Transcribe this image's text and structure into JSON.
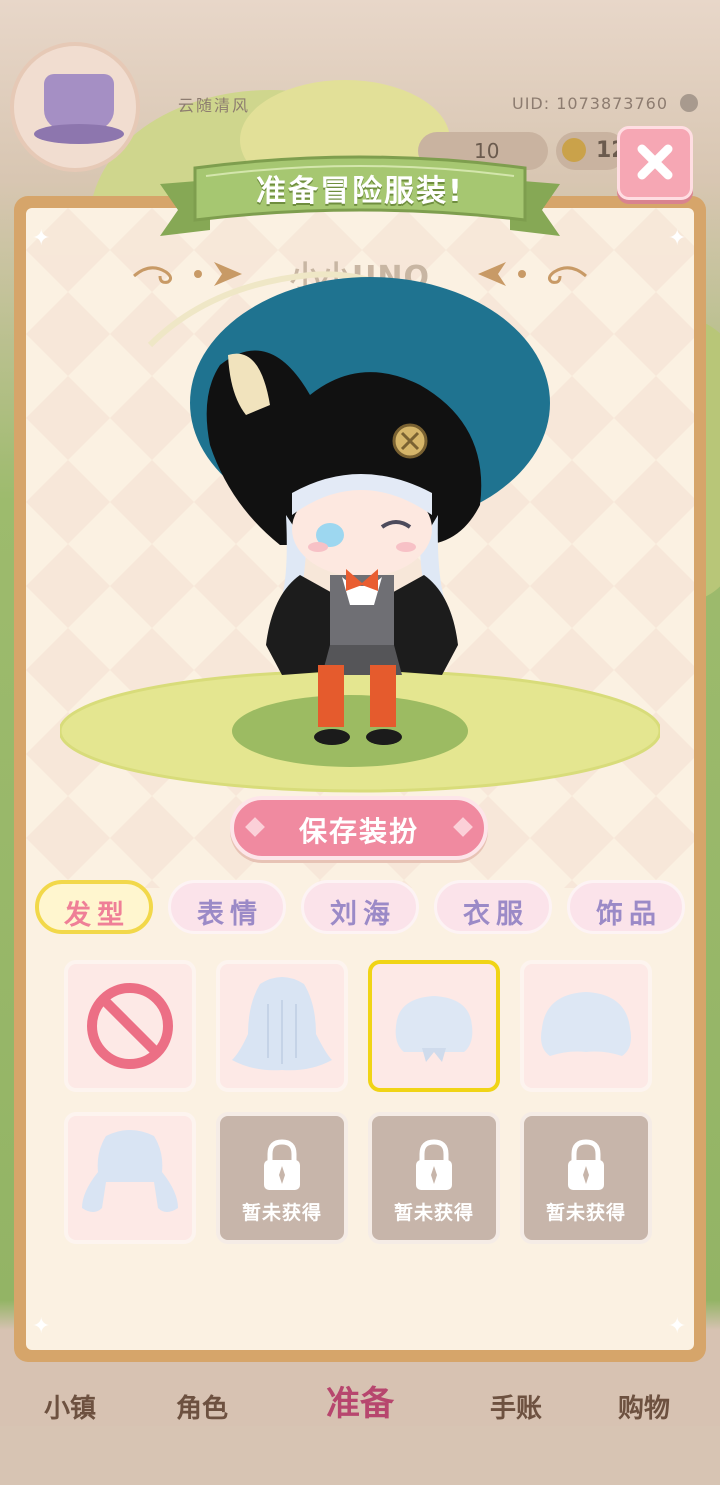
{
  "background": {
    "player_name": "云随清风",
    "uid": "UID: 1073873760",
    "currency_1": "10",
    "currency_2": "12",
    "bottom_nav": [
      "小镇",
      "角色",
      "准备",
      "手账",
      "购物"
    ]
  },
  "modal": {
    "title": "准备冒险服装!",
    "character_name": "小小UNO",
    "save_label": "保存装扮",
    "tabs": [
      {
        "label": "发型",
        "active": true
      },
      {
        "label": "表情",
        "active": false
      },
      {
        "label": "刘海",
        "active": false
      },
      {
        "label": "衣服",
        "active": false
      },
      {
        "label": "饰品",
        "active": false
      }
    ],
    "items": [
      {
        "type": "none-icon",
        "state": "available"
      },
      {
        "type": "long-hair",
        "state": "available"
      },
      {
        "type": "short-hair",
        "state": "selected"
      },
      {
        "type": "bob-hair",
        "state": "available"
      },
      {
        "type": "pigtail-hair",
        "state": "available"
      },
      {
        "type": "lock-icon",
        "state": "locked",
        "label": "暂未获得"
      },
      {
        "type": "lock-icon",
        "state": "locked",
        "label": "暂未获得"
      },
      {
        "type": "lock-icon",
        "state": "locked",
        "label": "暂未获得"
      }
    ]
  },
  "colors": {
    "accent_pink": "#f08aa0",
    "ribbon_green": "#9fc16a",
    "panel_frame": "#d6a56a",
    "selected_yellow": "#f0d416"
  }
}
